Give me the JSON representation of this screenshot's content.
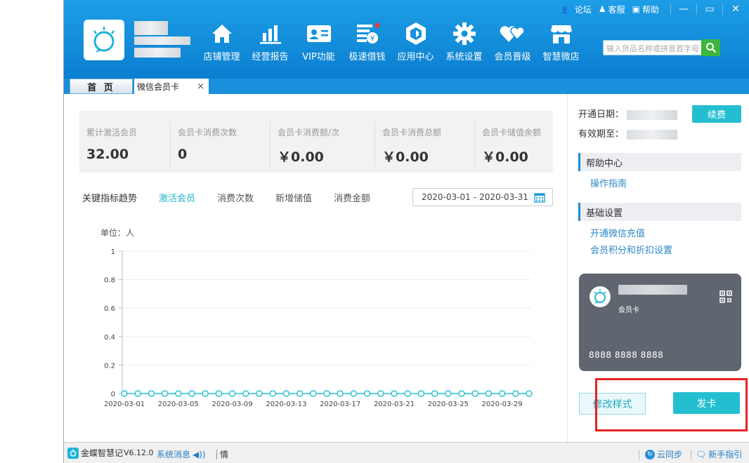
{
  "colors": {
    "header": "#1592dc",
    "accent": "#23bfd0",
    "link": "#2d8ac8",
    "highlight": "#e62222"
  },
  "topbar": {
    "forum": "论坛",
    "service": "客服",
    "help": "帮助"
  },
  "nav": [
    {
      "label": "店铺管理",
      "icon": "home-icon"
    },
    {
      "label": "经营报告",
      "icon": "bar-chart-icon"
    },
    {
      "label": "VIP功能",
      "icon": "vip-card-icon"
    },
    {
      "label": "极速借钱",
      "icon": "money-icon"
    },
    {
      "label": "应用中心",
      "icon": "app-cube-icon"
    },
    {
      "label": "系统设置",
      "icon": "gear-icon"
    },
    {
      "label": "会员晋级",
      "icon": "hearts-icon"
    },
    {
      "label": "智慧微店",
      "icon": "shop-icon"
    }
  ],
  "search": {
    "placeholder": "输入货品名称或拼音首字母"
  },
  "tabs": {
    "home": "首 页",
    "wx": "微信会员卡",
    "close": "×"
  },
  "stats": [
    {
      "label": "累计激活会员",
      "value": "32.00"
    },
    {
      "label": "会员卡消费次数",
      "value": "0"
    },
    {
      "label": "会员卡消费额/次",
      "value": "￥0.00"
    },
    {
      "label": "会员卡消费总额",
      "value": "￥0.00"
    },
    {
      "label": "会员卡储值余额",
      "value": "￥0.00"
    }
  ],
  "trend": {
    "title": "关键指标趋势",
    "tabs": [
      "激活会员",
      "消费次数",
      "新增储值",
      "消费金额"
    ]
  },
  "date_range": {
    "start": "2020-03-01",
    "sep": "-",
    "end": "2020-03-31"
  },
  "chart_data": {
    "type": "line",
    "ylabel": "单位：人",
    "ylim": [
      0,
      1
    ],
    "yticks": [
      "0",
      "0.2",
      "0.4",
      "0.6",
      "0.8",
      "1"
    ],
    "xtick_labels": [
      "2020-03-01",
      "2020-03-05",
      "2020-03-09",
      "2020-03-13",
      "2020-03-17",
      "2020-03-21",
      "2020-03-25",
      "2020-03-29"
    ],
    "x": [
      "2020-03-01",
      "2020-03-02",
      "2020-03-03",
      "2020-03-04",
      "2020-03-05",
      "2020-03-06",
      "2020-03-07",
      "2020-03-08",
      "2020-03-09",
      "2020-03-10",
      "2020-03-11",
      "2020-03-12",
      "2020-03-13",
      "2020-03-14",
      "2020-03-15",
      "2020-03-16",
      "2020-03-17",
      "2020-03-18",
      "2020-03-19",
      "2020-03-20",
      "2020-03-21",
      "2020-03-22",
      "2020-03-23",
      "2020-03-24",
      "2020-03-25",
      "2020-03-26",
      "2020-03-27",
      "2020-03-28",
      "2020-03-29",
      "2020-03-30",
      "2020-03-31"
    ],
    "values": [
      0,
      0,
      0,
      0,
      0,
      0,
      0,
      0,
      0,
      0,
      0,
      0,
      0,
      0,
      0,
      0,
      0,
      0,
      0,
      0,
      0,
      0,
      0,
      0,
      0,
      0,
      0,
      0,
      0,
      0,
      0
    ],
    "grid": true,
    "color": "#23bfd0"
  },
  "side": {
    "open_date_label": "开通日期：",
    "expiry_label": "有效期至：",
    "renew": "续费",
    "help_title": "帮助中心",
    "help_link": "操作指南",
    "basic_title": "基础设置",
    "basic_links": [
      "开通微信充值",
      "会员积分和折扣设置"
    ],
    "card_type": "会员卡",
    "card_number": "8888 8888 8888",
    "edit_style": "修改样式",
    "issue_card": "发卡"
  },
  "status": {
    "app": "金蝶智慧记",
    "version": "V6.12.0",
    "msg": "系统消息",
    "extra": "情",
    "sync": "云同步",
    "guide": "新手指引"
  }
}
